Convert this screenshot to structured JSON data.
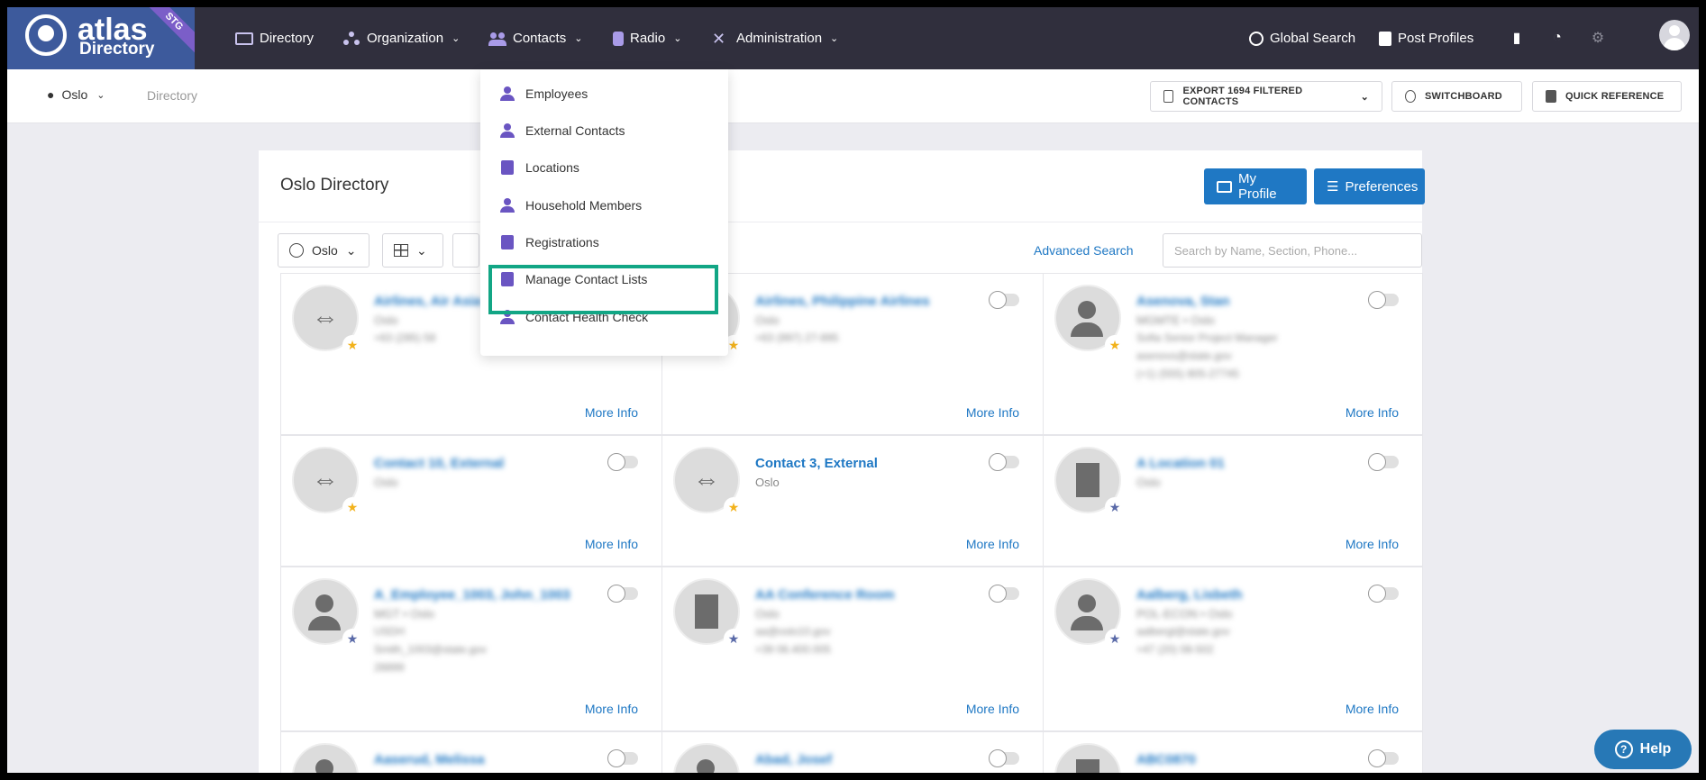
{
  "brand": {
    "name": "atlas",
    "product": "Directory",
    "env_badge": "STG"
  },
  "nav": {
    "items": [
      {
        "label": "Directory"
      },
      {
        "label": "Organization"
      },
      {
        "label": "Contacts"
      },
      {
        "label": "Radio"
      },
      {
        "label": "Administration"
      }
    ],
    "right": {
      "global_search": "Global Search",
      "post_profiles": "Post Profiles"
    }
  },
  "subheader": {
    "location": "Oslo",
    "breadcrumb": "Directory",
    "export_label": "EXPORT 1694 FILTERED CONTACTS",
    "switchboard_label": "SWITCHBOARD",
    "quick_reference_label": "QUICK REFERENCE"
  },
  "panel": {
    "title": "Oslo Directory",
    "my_profile_label": "My Profile",
    "preferences_label": "Preferences",
    "location_filter": "Oslo",
    "advanced_search": "Advanced Search",
    "search_placeholder": "Search by Name, Section, Phone..."
  },
  "contacts_menu": {
    "items": [
      {
        "label": "Employees"
      },
      {
        "label": "External Contacts"
      },
      {
        "label": "Locations"
      },
      {
        "label": "Household Members"
      },
      {
        "label": "Registrations"
      },
      {
        "label": "Manage Contact Lists"
      },
      {
        "label": "Contact Health Check"
      }
    ],
    "highlighted": "Manage Contact Lists"
  },
  "cards": [
    {
      "name": "Airlines, Air Asia",
      "sub": "Oslo",
      "lines": [
        "+63 (285) 58"
      ],
      "more": "More Info"
    },
    {
      "name": "Airlines, Philippine Airlines",
      "sub": "Oslo",
      "lines": [
        "+63 (997) 27-895"
      ],
      "more": "More Info"
    },
    {
      "name": "Asenova, Stan",
      "sub": "MGMTE • Oslo",
      "lines": [
        "Sofia Senior Project Manager",
        "asenovs@state.gov",
        "(+1) (555) 805-27745"
      ],
      "more": "More Info"
    },
    {
      "name": "Contact 10, External",
      "sub": "Oslo",
      "lines": [],
      "more": "More Info"
    },
    {
      "name": "Contact 3, External",
      "sub": "Oslo",
      "lines": [],
      "more": "More Info"
    },
    {
      "name": "A Location 01",
      "sub": "Oslo",
      "lines": [],
      "more": "More Info"
    },
    {
      "name": "A_Employee_1003, John_1003",
      "sub": "MGT • Oslo",
      "lines": [
        "USDH",
        "Smith_1003@state.gov",
        "28899"
      ],
      "more": "More Info"
    },
    {
      "name": "AA Conference Room",
      "sub": "Oslo",
      "lines": [
        "aa@oslo10.gov",
        "+39 06.400.005"
      ],
      "more": "More Info"
    },
    {
      "name": "Aalberg, Lisbeth",
      "sub": "POL-ECON • Oslo",
      "lines": [
        "aalbergl@state.gov",
        "+47 (20) 08-502"
      ],
      "more": "More Info"
    },
    {
      "name": "Aaserud, Melissa",
      "sub": "",
      "lines": [],
      "more": ""
    },
    {
      "name": "Abad, Josef",
      "sub": "",
      "lines": [],
      "more": ""
    },
    {
      "name": "ABC0870",
      "sub": "",
      "lines": [],
      "more": ""
    }
  ],
  "help": {
    "label": "Help"
  }
}
